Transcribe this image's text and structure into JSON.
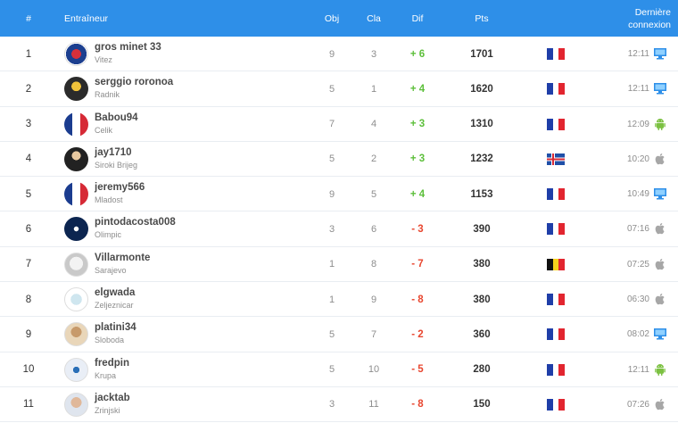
{
  "header": {
    "rank": "#",
    "coach": "Entraîneur",
    "obj": "Obj",
    "cla": "Cla",
    "dif": "Dif",
    "pts": "Pts",
    "last_line1": "Dernière",
    "last_line2": "connexion"
  },
  "colors": {
    "header_bg": "#2e8fe8",
    "positive": "#5cbf3a",
    "negative": "#e8462f",
    "desktop_icon": "#2e8fe8",
    "android_icon": "#7cc142",
    "apple_icon": "#a7a7a7"
  },
  "rows": [
    {
      "rank": "1",
      "name": "gros minet 33",
      "club": "Vitez",
      "obj": "9",
      "cla": "3",
      "dif": "+ 6",
      "pts": "1701",
      "flag": "france",
      "time": "12:11",
      "device": "desktop-icon"
    },
    {
      "rank": "2",
      "name": "serggio roronoa",
      "club": "Radnik",
      "obj": "5",
      "cla": "1",
      "dif": "+ 4",
      "pts": "1620",
      "flag": "france",
      "time": "12:11",
      "device": "desktop-icon"
    },
    {
      "rank": "3",
      "name": "Babou94",
      "club": "Celik",
      "obj": "7",
      "cla": "4",
      "dif": "+ 3",
      "pts": "1310",
      "flag": "france",
      "time": "12:09",
      "device": "android-icon"
    },
    {
      "rank": "4",
      "name": "jay1710",
      "club": "Siroki Brijeg",
      "obj": "5",
      "cla": "2",
      "dif": "+ 3",
      "pts": "1232",
      "flag": "iceland",
      "time": "10:20",
      "device": "apple-icon"
    },
    {
      "rank": "5",
      "name": "jeremy566",
      "club": "Mladost",
      "obj": "9",
      "cla": "5",
      "dif": "+ 4",
      "pts": "1153",
      "flag": "france",
      "time": "10:49",
      "device": "desktop-icon"
    },
    {
      "rank": "6",
      "name": "pintodacosta008",
      "club": "Olimpic",
      "obj": "3",
      "cla": "6",
      "dif": "- 3",
      "pts": "390",
      "flag": "france",
      "time": "07:16",
      "device": "apple-icon"
    },
    {
      "rank": "7",
      "name": "Villarmonte",
      "club": "Sarajevo",
      "obj": "1",
      "cla": "8",
      "dif": "- 7",
      "pts": "380",
      "flag": "belgium",
      "time": "07:25",
      "device": "apple-icon"
    },
    {
      "rank": "8",
      "name": "elgwada",
      "club": "Zeljeznicar",
      "obj": "1",
      "cla": "9",
      "dif": "- 8",
      "pts": "380",
      "flag": "france",
      "time": "06:30",
      "device": "apple-icon"
    },
    {
      "rank": "9",
      "name": "platini34",
      "club": "Sloboda",
      "obj": "5",
      "cla": "7",
      "dif": "- 2",
      "pts": "360",
      "flag": "france",
      "time": "08:02",
      "device": "desktop-icon"
    },
    {
      "rank": "10",
      "name": "fredpin",
      "club": "Krupa",
      "obj": "5",
      "cla": "10",
      "dif": "- 5",
      "pts": "280",
      "flag": "france",
      "time": "12:11",
      "device": "android-icon"
    },
    {
      "rank": "11",
      "name": "jacktab",
      "club": "Zrinjski",
      "obj": "3",
      "cla": "11",
      "dif": "- 8",
      "pts": "150",
      "flag": "france",
      "time": "07:26",
      "device": "apple-icon"
    }
  ]
}
